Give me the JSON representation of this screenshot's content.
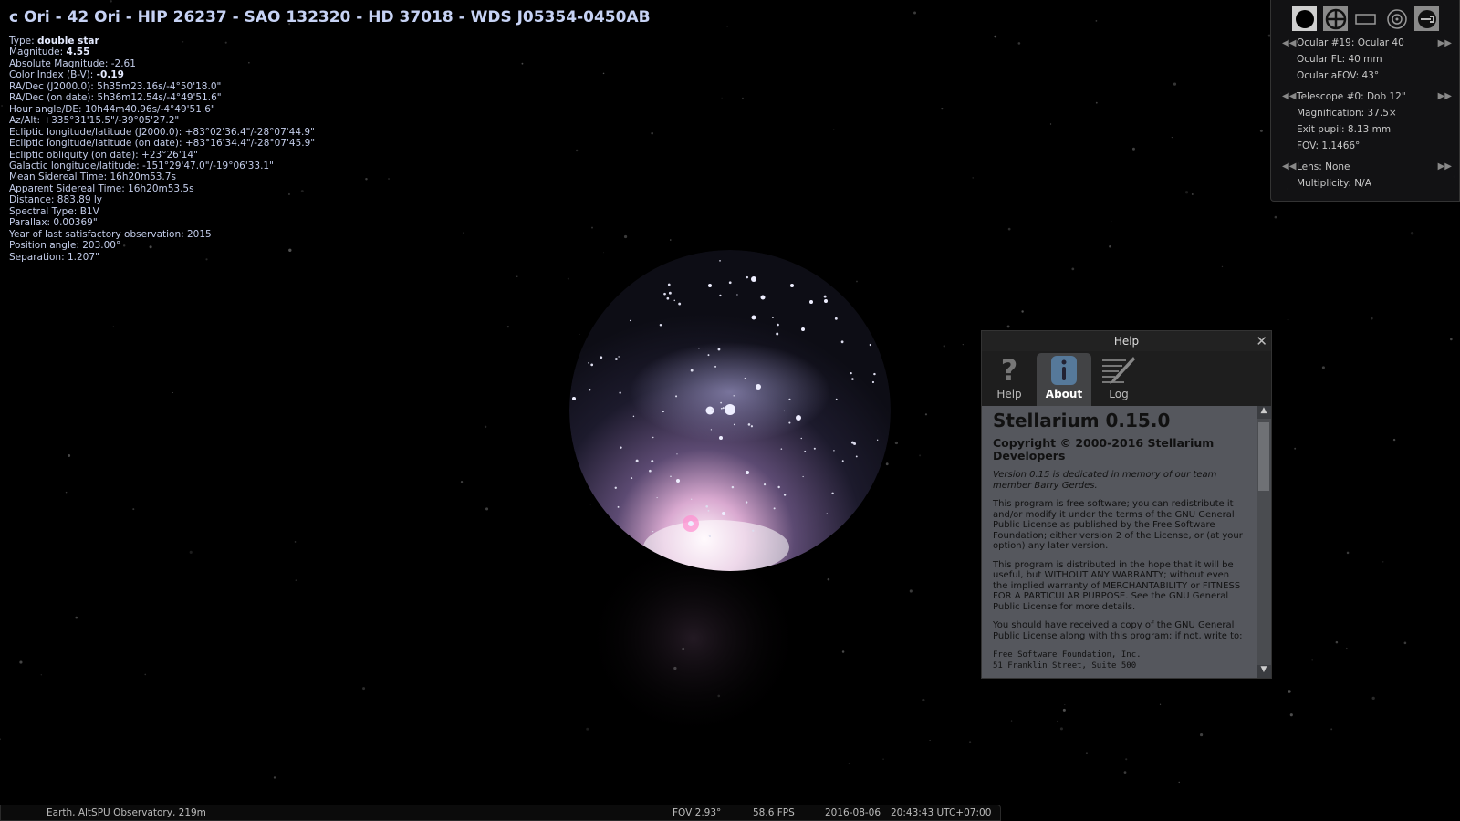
{
  "object": {
    "title": "c Ori - 42 Ori - HIP 26237 - SAO 132320 - HD 37018 - WDS J05354-0450AB",
    "lines": [
      {
        "label": "Type: ",
        "value": "double star",
        "bold": true
      },
      {
        "label": "Magnitude: ",
        "value": "4.55",
        "bold": true
      },
      {
        "label": "Absolute Magnitude: ",
        "value": "-2.61"
      },
      {
        "label": "Color Index (B-V): ",
        "value": "-0.19",
        "bold": true
      },
      {
        "label": "RA/Dec (J2000.0): ",
        "value": "5h35m23.16s/-4°50'18.0\""
      },
      {
        "label": "RA/Dec (on date): ",
        "value": "5h36m12.54s/-4°49'51.6\""
      },
      {
        "label": "Hour angle/DE: ",
        "value": "10h44m40.96s/-4°49'51.6\""
      },
      {
        "label": "Az/Alt: ",
        "value": "+335°31'15.5\"/-39°05'27.2\""
      },
      {
        "label": "Ecliptic longitude/latitude (J2000.0): ",
        "value": "+83°02'36.4\"/-28°07'44.9\""
      },
      {
        "label": "Ecliptic longitude/latitude (on date): ",
        "value": "+83°16'34.4\"/-28°07'45.9\""
      },
      {
        "label": "Ecliptic obliquity (on date): ",
        "value": "+23°26'14\""
      },
      {
        "label": "Galactic longitude/latitude: ",
        "value": "-151°29'47.0\"/-19°06'33.1\""
      },
      {
        "label": "Mean Sidereal Time: ",
        "value": "16h20m53.7s"
      },
      {
        "label": "Apparent Sidereal Time: ",
        "value": "16h20m53.5s"
      },
      {
        "label": "Distance: ",
        "value": "883.89 ly"
      },
      {
        "label": "Spectral Type: ",
        "value": "B1V"
      },
      {
        "label": "Parallax: ",
        "value": "0.00369\""
      },
      {
        "label": "Year of last satisfactory observation: ",
        "value": "2015"
      },
      {
        "label": "Position angle: ",
        "value": "203.00°"
      },
      {
        "label": "Separation: ",
        "value": "1.207\""
      }
    ]
  },
  "oculars": {
    "buttons": [
      "eyepiece-view-icon",
      "crosshair-icon",
      "ccd-frame-icon",
      "telrad-icon",
      "settings-wrench-icon"
    ],
    "ocular": "Ocular #19: Ocular 40",
    "ocular_fl": "Ocular FL: 40 mm",
    "ocular_afov": "Ocular aFOV: 43°",
    "telescope": "Telescope #0: Dob 12\"",
    "magnification": "Magnification: 37.5×",
    "exit_pupil": "Exit pupil: 8.13 mm",
    "fov": "FOV: 1.1466°",
    "lens": "Lens: None",
    "multiplicity": "Multiplicity: N/A"
  },
  "help_dialog": {
    "title": "Help",
    "tabs": [
      {
        "label": "Help",
        "icon": "question-icon"
      },
      {
        "label": "About",
        "icon": "info-icon",
        "active": true
      },
      {
        "label": "Log",
        "icon": "pencil-log-icon"
      }
    ],
    "heading": "Stellarium 0.15.0",
    "copyright": "Copyright © 2000-2016 Stellarium Developers",
    "dedication": "Version 0.15 is dedicated in memory of our team member Barry Gerdes.",
    "para1": "This program is free software; you can redistribute it and/or modify it under the terms of the GNU General Public License as published by the Free Software Foundation; either version 2 of the License, or (at your option) any later version.",
    "para2": "This program is distributed in the hope that it will be useful, but WITHOUT ANY WARRANTY; without even the implied warranty of MERCHANTABILITY or FITNESS FOR A PARTICULAR PURPOSE. See the GNU General Public License for more details.",
    "para3": "You should have received a copy of the GNU General Public License along with this program; if not, write to:",
    "address1": "Free Software Foundation, Inc.",
    "address2": "51 Franklin Street, Suite 500"
  },
  "status_bar": {
    "location": "Earth, AltSPU Observatory, 219m",
    "fov": "FOV 2.93°",
    "fps": "58.6 FPS",
    "date": "2016-08-06",
    "time": "20:43:43 UTC+07:00"
  }
}
